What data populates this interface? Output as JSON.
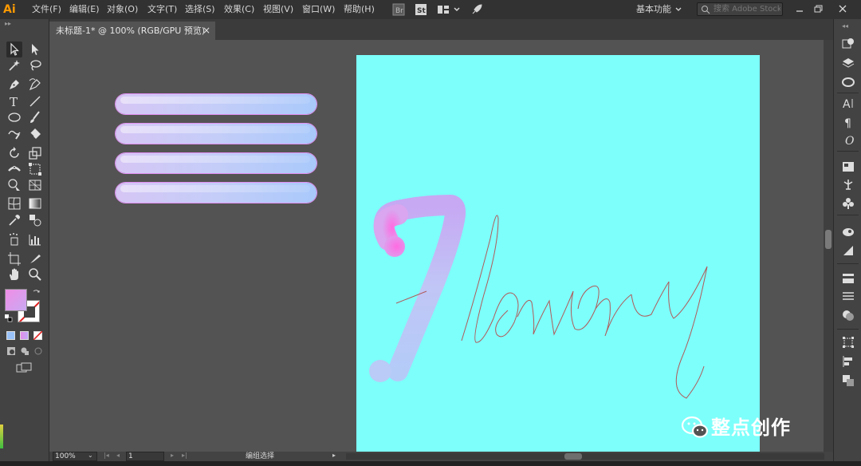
{
  "app": {
    "logo": "Ai"
  },
  "menu": [
    "文件(F)",
    "编辑(E)",
    "对象(O)",
    "文字(T)",
    "选择(S)",
    "效果(C)",
    "视图(V)",
    "窗口(W)",
    "帮助(H)"
  ],
  "toolbar": {
    "workspace_label": "基本功能",
    "search_placeholder": "搜索 Adobe Stock"
  },
  "document_tab": {
    "title": "未标题-1* @ 100% (RGB/GPU 预览)",
    "close": "×"
  },
  "statusbar": {
    "zoom": "100%",
    "artboard_number": "1",
    "status_text": "编组选择"
  },
  "watermark": {
    "text": "整点创作"
  },
  "colors": {
    "artboard": "#7dfffb",
    "gradient_start": "#f07fe0",
    "gradient_end": "#a9c9fb",
    "outline_stroke": "#b05a5a",
    "chrome_dark": "#323232",
    "chrome_mid": "#434343",
    "pasteboard": "#535353"
  },
  "canvas": {
    "gradient_bars_count": 4,
    "script_text": "Flowery"
  },
  "tools": [
    "selection-tool",
    "direct-selection-tool",
    "magic-wand-tool",
    "lasso-tool",
    "pen-tool",
    "curvature-tool",
    "type-tool",
    "line-segment-tool",
    "ellipse-tool",
    "paintbrush-tool",
    "shaper-tool",
    "eraser-tool",
    "rotate-tool",
    "scale-tool",
    "width-tool",
    "free-transform-tool",
    "shape-builder-tool",
    "perspective-grid-tool",
    "mesh-tool",
    "gradient-tool",
    "eyedropper-tool",
    "blend-tool",
    "symbol-sprayer-tool",
    "column-graph-tool",
    "artboard-tool",
    "slice-tool",
    "hand-tool",
    "zoom-tool"
  ],
  "dock_icons": [
    "libraries-icon",
    "layers-icon",
    "cc-libraries-icon",
    "character-icon",
    "paragraph-icon",
    "opentype-icon",
    "image-trace-icon",
    "puppet-icon",
    "symbols-icon",
    "appearance-icon",
    "graphic-styles-icon",
    "stroke-icon",
    "gradient-panel-icon",
    "transparency-icon",
    "transform-icon",
    "align-icon",
    "pathfinder-icon"
  ]
}
